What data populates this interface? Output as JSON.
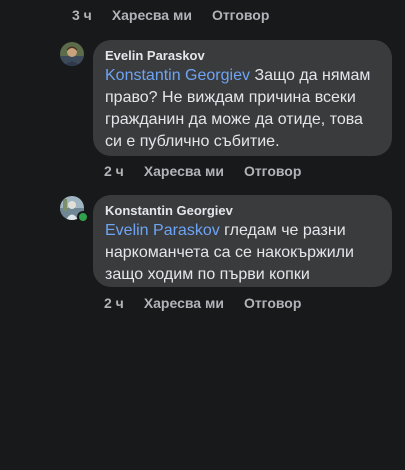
{
  "top_actions": {
    "time": "3 ч",
    "like": "Харесва ми",
    "reply": "Отговор"
  },
  "comments": [
    {
      "author": "Evelin Paraskov",
      "mention": "Konstantin Georgiev",
      "text": "Защо да нямам право? Не виждам причина всеки гражданин да може да отиде, това си е публично събитие.",
      "actions": {
        "time": "2 ч",
        "like": "Харесва ми",
        "reply": "Отговор"
      }
    },
    {
      "author": "Konstantin Georgiev",
      "mention": "Evelin Paraskov",
      "text": "гледам че разни наркоманчета са се накокържили защо ходим по първи копки",
      "actions": {
        "time": "2 ч",
        "like": "Харесва ми",
        "reply": "Отговор"
      }
    }
  ],
  "colors": {
    "background": "#18191a",
    "bubble": "#3a3b3c",
    "mention": "#6ea4f5",
    "meta_text": "#b0b3b8",
    "online": "#31a24c"
  },
  "icons": {
    "evelin_avatar": "avatar-photo-icon",
    "konstantin_avatar": "avatar-photo-icon",
    "online_status": "online-dot-icon"
  }
}
